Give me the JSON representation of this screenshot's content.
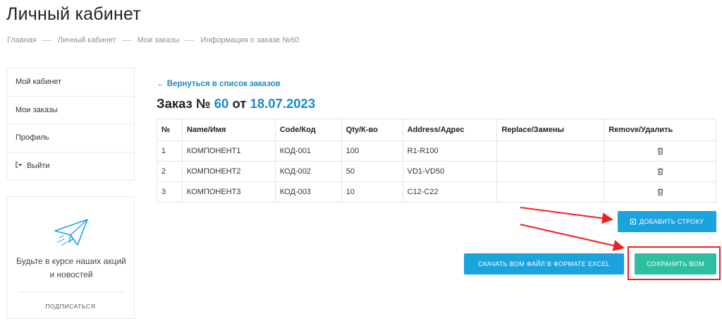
{
  "page": {
    "title": "Личный кабинет"
  },
  "breadcrumb": [
    "Главная",
    "Личный кабинет",
    "Мои заказы",
    "Информация о заказе №60"
  ],
  "sidebar": {
    "items": [
      {
        "label": "Мой кабинет"
      },
      {
        "label": "Мои заказы"
      },
      {
        "label": "Профиль"
      },
      {
        "label": "Выйти",
        "icon": "logout-icon"
      }
    ]
  },
  "subscribe": {
    "icon": "paper-plane-icon",
    "text": "Будьте в курсе наших акций и новостей",
    "link": "ПОДПИСАТЬСЯ"
  },
  "order": {
    "back_link": "← Вернуться в список заказов",
    "title_prefix": "Заказ №",
    "number": "60",
    "title_mid": "от",
    "date": "18.07.2023"
  },
  "table": {
    "headers": [
      "№",
      "Name/Имя",
      "Code/Код",
      "Qty/К-во",
      "Address/Адрес",
      "Replace/Замены",
      "Remove/Удалить"
    ],
    "rows": [
      {
        "n": "1",
        "name": "КОМПОНЕНТ1",
        "code": "КОД-001",
        "qty": "100",
        "address": "R1-R100",
        "replace": ""
      },
      {
        "n": "2",
        "name": "КОМПОНЕНТ2",
        "code": "КОД-002",
        "qty": "50",
        "address": "VD1-VD50",
        "replace": ""
      },
      {
        "n": "3",
        "name": "КОМПОНЕНТ3",
        "code": "КОД-003",
        "qty": "10",
        "address": "C12-C22",
        "replace": ""
      }
    ]
  },
  "buttons": {
    "add_row": "ДОБАВИТЬ СТРОКУ",
    "download_excel": "СКАЧАТЬ BOM ФАЙЛ В ФОРМАТЕ EXCEL",
    "save_bom": "СОХРАНИТЬ BOM"
  },
  "colors": {
    "accent": "#1a8cc9",
    "button_blue": "#1aa3dc",
    "button_green": "#2fbfa0",
    "annotation_red": "#ee2020"
  }
}
